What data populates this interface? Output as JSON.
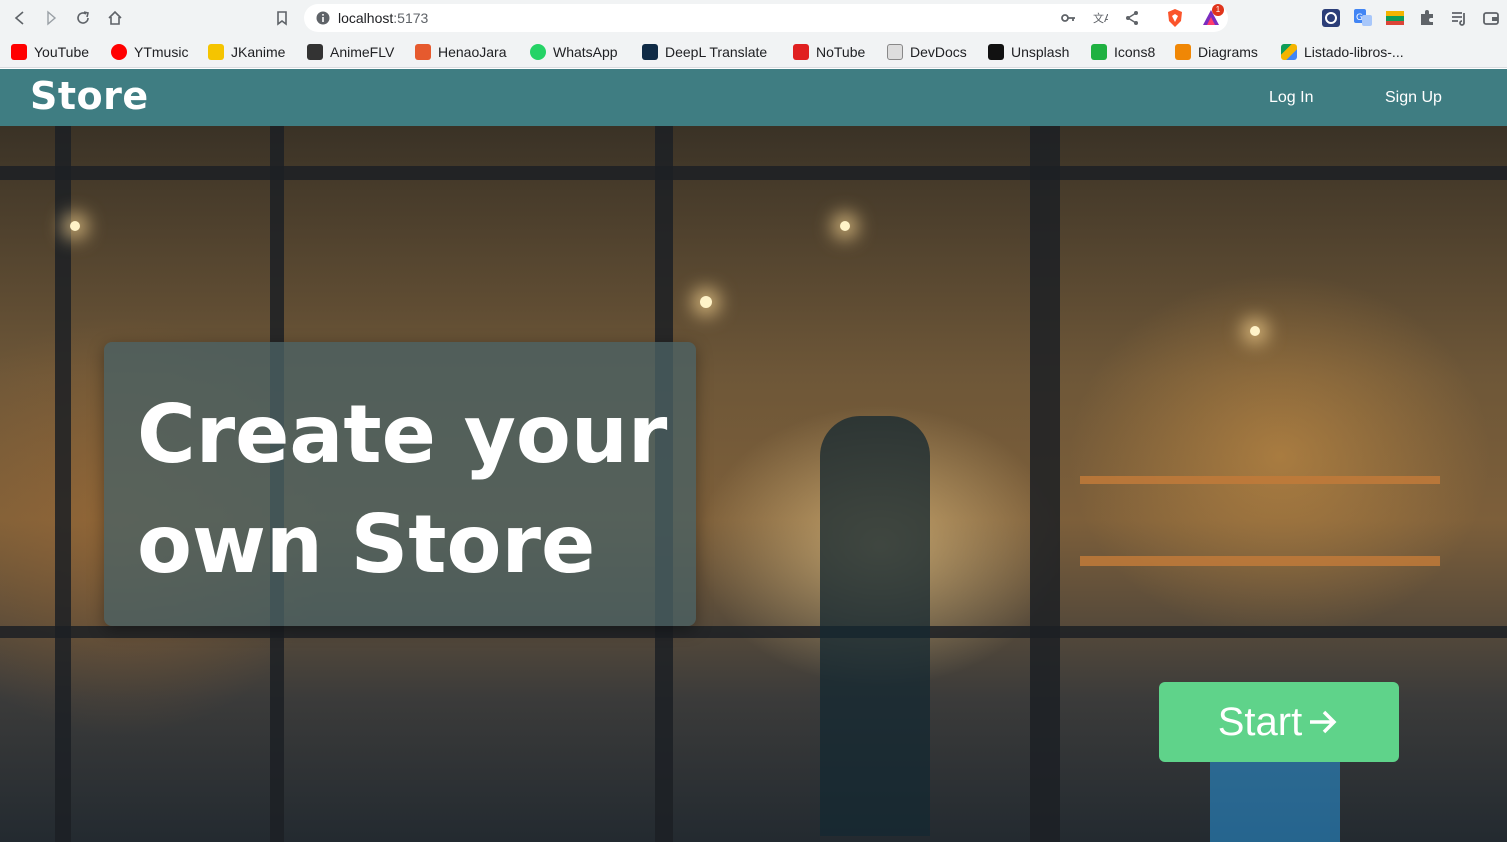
{
  "browser": {
    "url_host": "localhost",
    "url_port": ":5173",
    "brave_badge_count": "1",
    "toolbar_icons": [
      "back-icon",
      "forward-icon",
      "reload-icon",
      "home-icon",
      "bookmark-icon",
      "key-icon",
      "translate-icon",
      "share-icon",
      "brave-shield-icon",
      "brave-rewards-icon",
      "extension-1-icon",
      "extension-translate-icon",
      "extension-color-icon",
      "puzzle-icon",
      "media-queue-icon",
      "wallet-icon"
    ]
  },
  "bookmarks": [
    {
      "label": "YouTube",
      "icon": "youtube-icon",
      "color": "#ff0000"
    },
    {
      "label": "YTmusic",
      "icon": "ytmusic-icon",
      "color": "#ff0000"
    },
    {
      "label": "JKanime",
      "icon": "jkanime-icon",
      "color": "#f5c400"
    },
    {
      "label": "AnimeFLV",
      "icon": "animeflv-icon",
      "color": "#333333"
    },
    {
      "label": "HenaoJara",
      "icon": "henaojara-icon",
      "color": "#e65a2e"
    },
    {
      "label": "WhatsApp",
      "icon": "whatsapp-icon",
      "color": "#25d366"
    },
    {
      "label": "DeepL Translate",
      "icon": "deepl-icon",
      "color": "#0f2b46"
    },
    {
      "label": "NoTube",
      "icon": "notube-icon",
      "color": "#e02020"
    },
    {
      "label": "DevDocs",
      "icon": "devdocs-icon",
      "color": "#888888"
    },
    {
      "label": "Unsplash",
      "icon": "unsplash-icon",
      "color": "#111111"
    },
    {
      "label": "Icons8",
      "icon": "icons8-icon",
      "color": "#1fb141"
    },
    {
      "label": "Diagrams",
      "icon": "diagrams-icon",
      "color": "#f08705"
    },
    {
      "label": "Listado-libros-...",
      "icon": "google-drive-icon",
      "color": "#4285f4"
    }
  ],
  "app": {
    "brand": "Store",
    "nav": {
      "login": "Log  In",
      "signup": "Sign Up"
    },
    "hero": {
      "title": "Create your own Store",
      "start_label": "Start"
    },
    "colors": {
      "navbar": "#3f7d82",
      "start_button": "#5fd38a",
      "title_card": "#4a6264"
    }
  }
}
